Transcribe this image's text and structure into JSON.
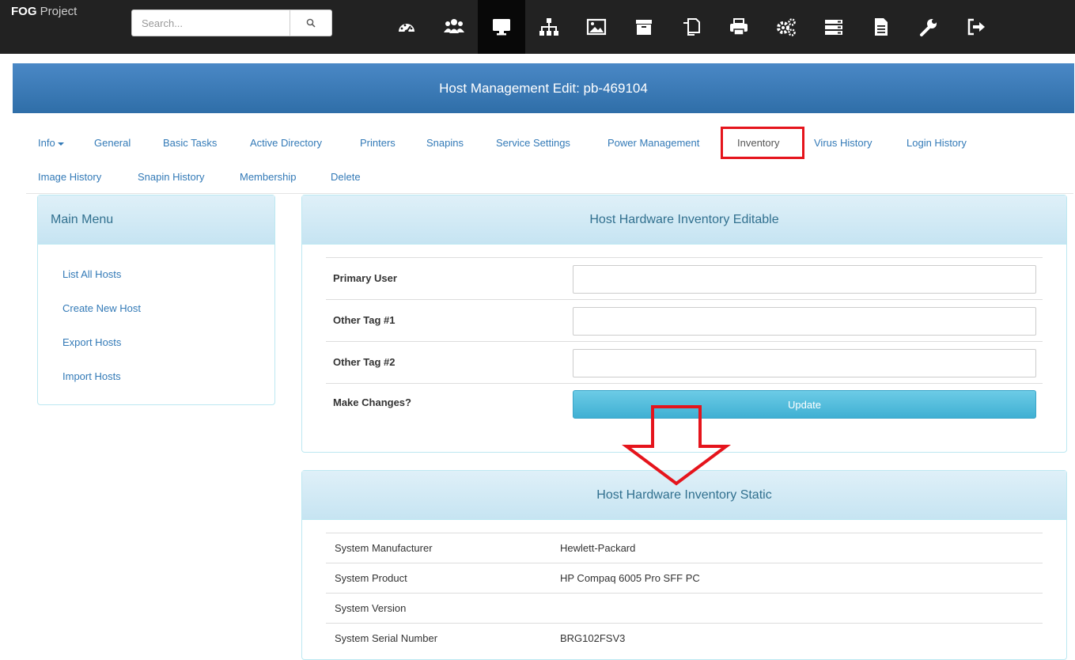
{
  "navbar": {
    "brand_bold": "FOG",
    "brand_rest": " Project",
    "search_placeholder": "Search...",
    "icons": [
      "dashboard-icon",
      "users-icon",
      "desktop-icon",
      "sitemap-icon",
      "image-icon",
      "archive-icon",
      "copy-icon",
      "print-icon",
      "cogs-icon",
      "server-icon",
      "file-icon",
      "wrench-icon",
      "logout-icon"
    ],
    "active_icon": "desktop-icon"
  },
  "header": {
    "title": "Host Management Edit: pb-469104"
  },
  "subnav": {
    "row1": [
      "Info",
      "General",
      "Basic Tasks",
      "Active Directory",
      "Printers",
      "Snapins",
      "Service Settings",
      "Power Management",
      "Inventory",
      "Virus History",
      "Login History"
    ],
    "row2": [
      "Image History",
      "Snapin History",
      "Membership",
      "Delete"
    ]
  },
  "main_menu": {
    "title": "Main Menu",
    "items": [
      "List All Hosts",
      "Create New Host",
      "Export Hosts",
      "Import Hosts"
    ]
  },
  "editable": {
    "title": "Host Hardware Inventory Editable",
    "fields": [
      {
        "label": "Primary User",
        "value": ""
      },
      {
        "label": "Other Tag #1",
        "value": ""
      },
      {
        "label": "Other Tag #2",
        "value": ""
      }
    ],
    "changes_label": "Make Changes?",
    "update_label": "Update"
  },
  "static": {
    "title": "Host Hardware Inventory Static",
    "rows": [
      {
        "key": "System Manufacturer",
        "value": "Hewlett-Packard"
      },
      {
        "key": "System Product",
        "value": "HP Compaq 6005 Pro SFF PC"
      },
      {
        "key": "System Version",
        "value": ""
      },
      {
        "key": "System Serial Number",
        "value": "BRG102FSV3"
      }
    ]
  },
  "colors": {
    "navbar": "#222222",
    "header": "#3a79b9",
    "link": "#337ab7",
    "highlight": "#e5141c",
    "update": "#5bc0de"
  }
}
